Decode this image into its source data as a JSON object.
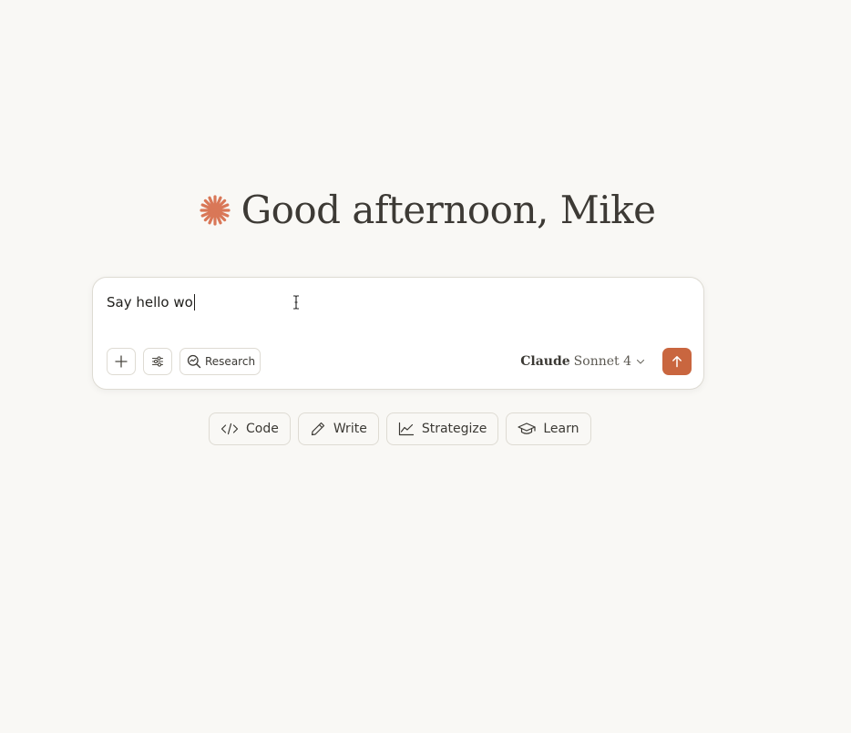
{
  "greeting": {
    "text": "Good afternoon, Mike",
    "icon": "claude-spark-icon",
    "icon_color": "#d97757"
  },
  "composer": {
    "input_value": "Say hello wo",
    "add_icon": "plus-icon",
    "tools_icon": "sliders-icon",
    "research_label": "Research",
    "research_icon": "search-research-icon",
    "model": {
      "name": "Claude",
      "version": "Sonnet 4"
    },
    "send_icon": "arrow-up-icon",
    "send_color": "#c9663f"
  },
  "chips": [
    {
      "label": "Code",
      "icon": "code-icon"
    },
    {
      "label": "Write",
      "icon": "pencil-icon"
    },
    {
      "label": "Strategize",
      "icon": "chart-line-icon"
    },
    {
      "label": "Learn",
      "icon": "graduation-cap-icon"
    }
  ]
}
